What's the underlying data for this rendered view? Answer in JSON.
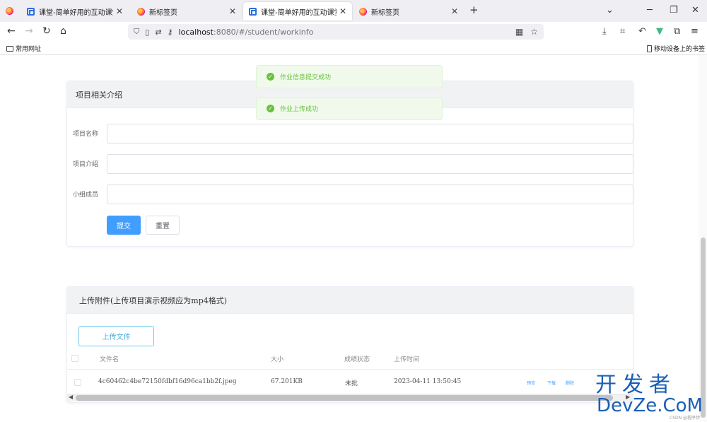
{
  "browser": {
    "tabs": [
      {
        "label": "课堂-简单好用的互动课堂管理工",
        "icon": "classroom-icon",
        "active": false
      },
      {
        "label": "新标签页",
        "icon": "firefox-icon",
        "active": false
      },
      {
        "label": "课堂-简单好用的互动课堂管理工",
        "icon": "classroom-icon",
        "active": true
      },
      {
        "label": "新标签页",
        "icon": "firefox-icon",
        "active": false
      }
    ],
    "new_tab": "+",
    "url_host": "localhost",
    "url_rest": ":8080/#/student/workinfo",
    "bookmarks": {
      "left": "常用网址",
      "right": "移动设备上的书签"
    }
  },
  "toasts": [
    {
      "text": "作业信息提交成功"
    },
    {
      "text": "作业上传成功"
    }
  ],
  "project_card": {
    "title": "项目相关介绍",
    "fields": [
      {
        "label": "项目名称",
        "value": ""
      },
      {
        "label": "项目介绍",
        "value": ""
      },
      {
        "label": "小组成员",
        "value": ""
      }
    ],
    "submit": "提交",
    "reset": "重置"
  },
  "upload_card": {
    "title": "上传附件(上传项目演示视频应为mp4格式)",
    "upload_button": "上传文件",
    "columns": [
      "文件名",
      "大小",
      "成绩状态",
      "上传时间"
    ],
    "rows": [
      {
        "name": "4c60462c4be72150fdbf16d96ca1bb2f.jpeg",
        "size": "67.201KB",
        "status": "未批",
        "time": "2023-04-11 13:50:45",
        "actions": [
          "预览",
          "下载",
          "删除"
        ]
      }
    ]
  },
  "watermark": {
    "line1": "开发者",
    "line2": "DevZe.CoM",
    "small": "CSDN @程序伊"
  },
  "colors": {
    "primary": "#409eff",
    "success": "#67c23a",
    "header_bg": "#f1f2f4"
  }
}
